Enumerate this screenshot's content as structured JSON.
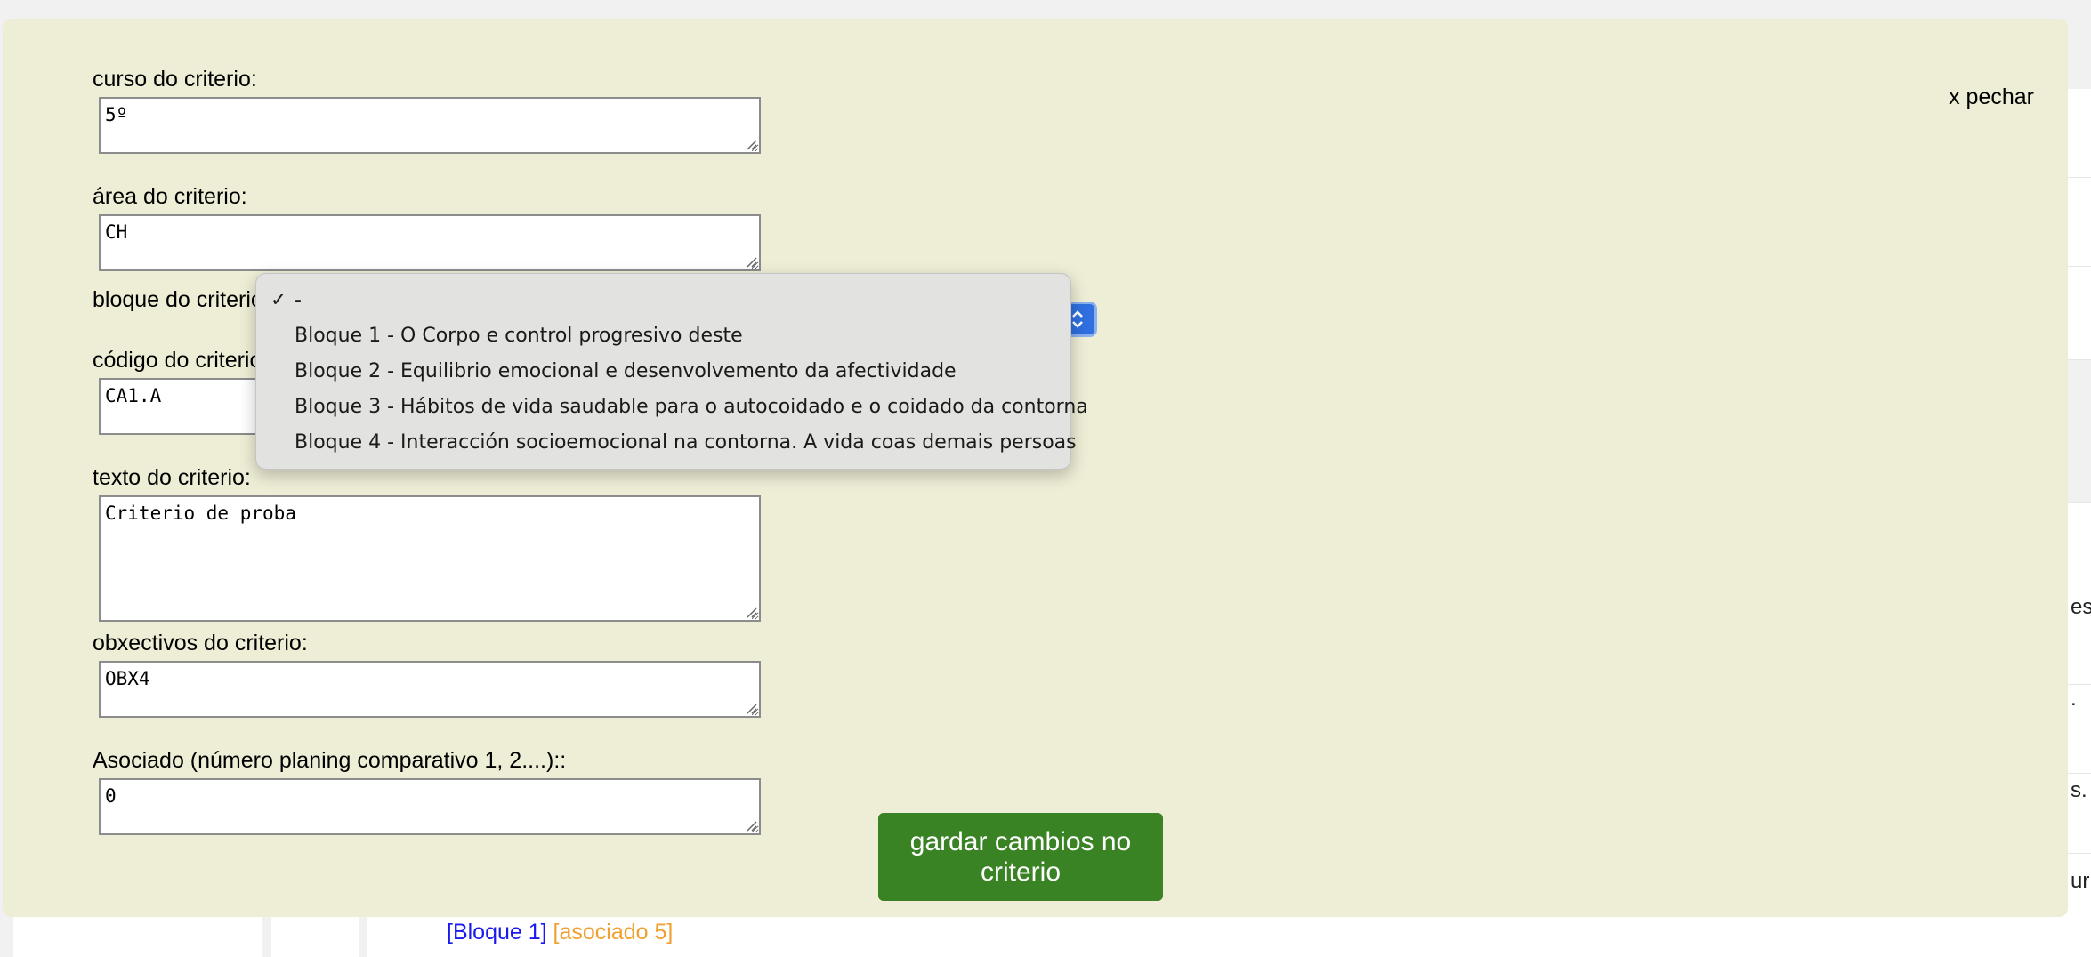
{
  "modal": {
    "close_label": "x pechar",
    "fields": {
      "curso": {
        "label": "curso do criterio:",
        "value": "5º"
      },
      "area": {
        "label": "área do criterio:",
        "value": "CH"
      },
      "bloque": {
        "label": "bloque do criterio:"
      },
      "codigo": {
        "label": "código do criterio:",
        "value": "CA1.A"
      },
      "texto": {
        "label": "texto do criterio:",
        "value": "Criterio de proba"
      },
      "obxectivos": {
        "label": "obxectivos do criterio:",
        "value": "OBX4"
      },
      "asociado": {
        "label": "Asociado (número planing comparativo 1, 2....)::",
        "value": "0"
      }
    },
    "save_label": "gardar cambios no criterio"
  },
  "dropdown": {
    "selected": "-",
    "options": [
      "-",
      "Bloque 1 - O Corpo e control progresivo deste",
      "Bloque 2 - Equilibrio emocional e desenvolvemento da afectividade",
      "Bloque 3 - Hábitos de vida saudable para o autocoidado e o coidado da contorna",
      "Bloque 4 - Interacción socioemocional na contorna. A vida coas demais persoas"
    ]
  },
  "background": {
    "bottom_tags": {
      "bloque": "[Bloque 1]",
      "asociado": "[asociado 5]"
    },
    "right_fragments": [
      "es",
      ".",
      "s.",
      "ur"
    ]
  },
  "colors": {
    "modal_bg": "#eeeed6",
    "save_button": "#3a8324",
    "tag_bloque": "#1a1aee",
    "tag_asociado": "#f0a030",
    "select_accent": "#2f6fe0"
  }
}
